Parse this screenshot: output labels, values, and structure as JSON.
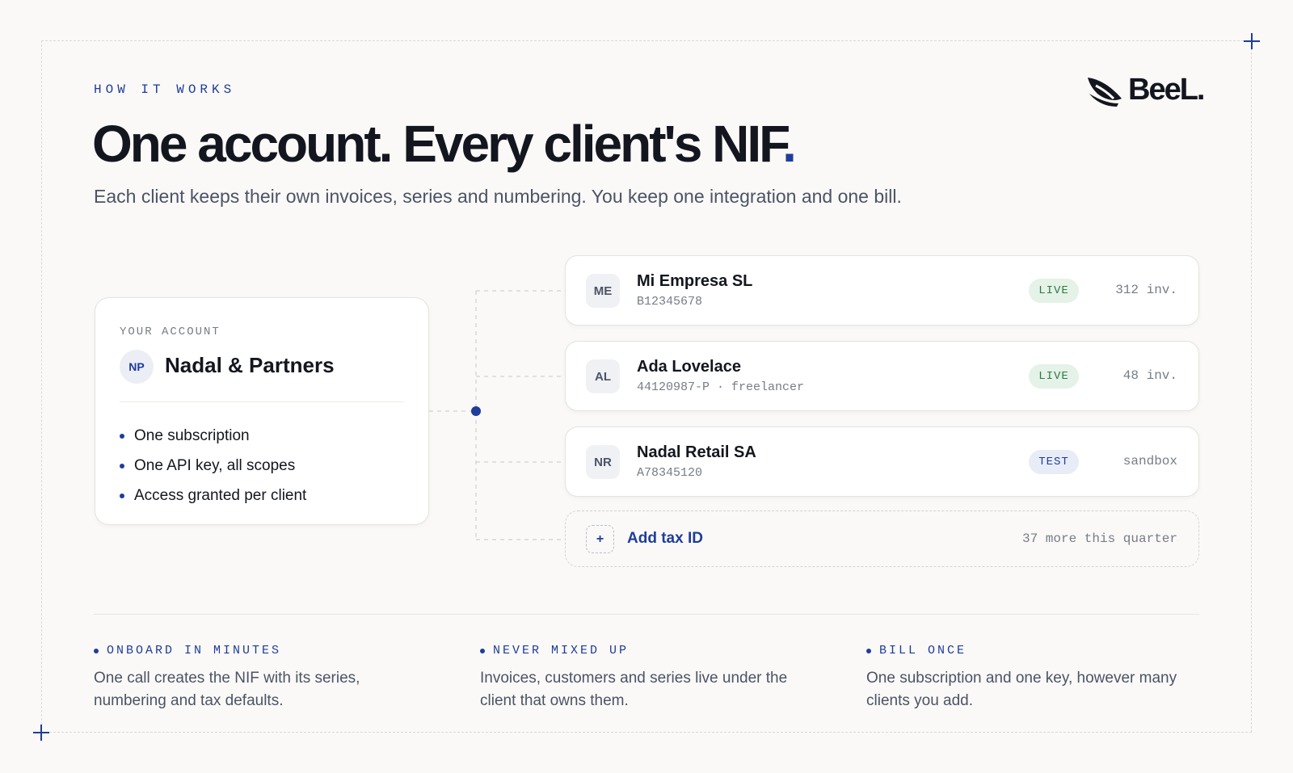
{
  "eyebrow": "HOW IT WORKS",
  "logo": {
    "text": "BeeL."
  },
  "headline": {
    "text": "One account. Every client's NIF",
    "dot": "."
  },
  "subhead": "Each client keeps their own invoices, series and numbering. You keep one integration and one bill.",
  "account": {
    "label": "YOUR ACCOUNT",
    "initials": "NP",
    "name": "Nadal & Partners",
    "perks": [
      "One subscription",
      "One API key, all scopes",
      "Access granted per client"
    ]
  },
  "clients": [
    {
      "initials": "ME",
      "name": "Mi Empresa SL",
      "tax_id": "B12345678",
      "status": "LIVE",
      "count": "312 inv."
    },
    {
      "initials": "AL",
      "name": "Ada Lovelace",
      "tax_id": "44120987-P · freelancer",
      "status": "LIVE",
      "count": "48 inv."
    },
    {
      "initials": "NR",
      "name": "Nadal Retail SA",
      "tax_id": "A78345120",
      "status": "TEST",
      "count": "sandbox"
    }
  ],
  "add_client": {
    "icon": "+",
    "label": "Add tax ID",
    "note": "37 more this quarter"
  },
  "features": [
    {
      "title": "ONBOARD IN MINUTES",
      "desc": "One call creates the NIF with its series, numbering and tax defaults."
    },
    {
      "title": "NEVER MIXED UP",
      "desc": "Invoices, customers and series live under the client that owns them."
    },
    {
      "title": "BILL ONCE",
      "desc": "One subscription and one key, however many clients you add."
    }
  ],
  "colors": {
    "accent": "#1f3d99",
    "live": "#2f7a45",
    "background": "#faf9f7"
  }
}
